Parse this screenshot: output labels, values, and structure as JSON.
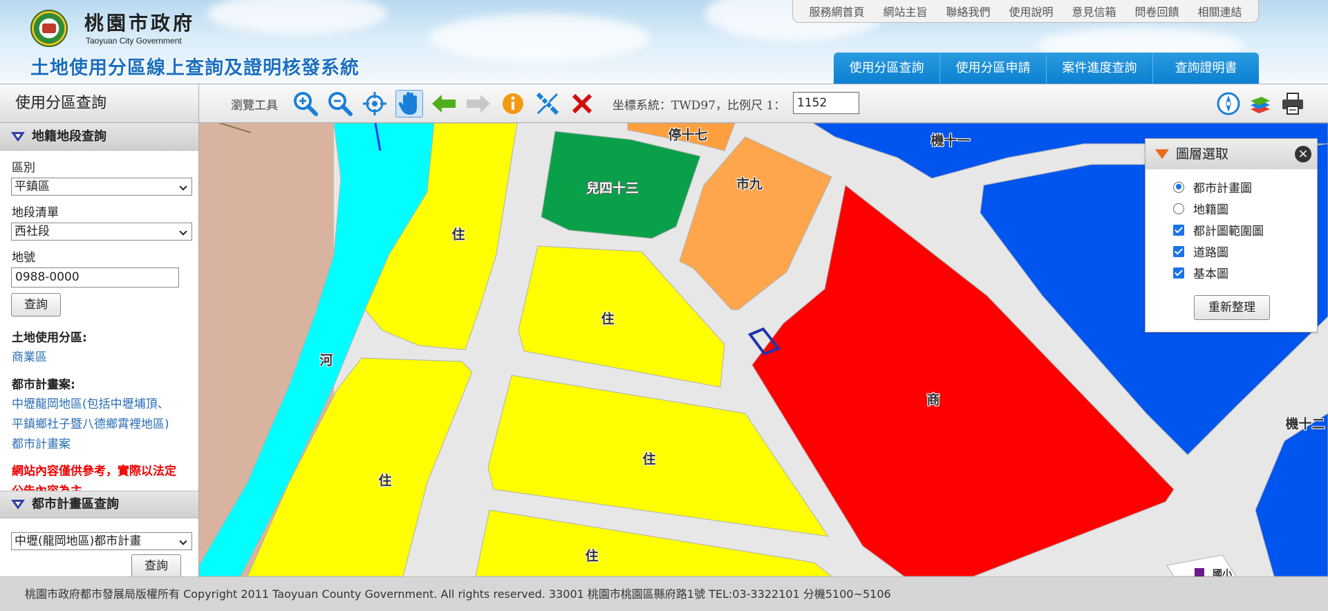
{
  "header": {
    "gov_name": "桃園市政府",
    "gov_name_en": "Taoyuan City Government",
    "system_title": "土地使用分區線上查詢及證明核發系統",
    "top_links": [
      "服務網首頁",
      "網站主旨",
      "聯絡我們",
      "使用說明",
      "意見信箱",
      "問卷回饋",
      "相關連結"
    ],
    "main_nav": [
      "使用分區查詢",
      "使用分區申請",
      "案件進度查詢",
      "查詢證明書"
    ]
  },
  "sidebar": {
    "title": "使用分區查詢",
    "land_section": {
      "heading": "地籍地段查詢",
      "district_label": "區別",
      "district_value": "平鎮區",
      "section_label": "地段清單",
      "section_value": "西社段",
      "lot_label": "地號",
      "lot_value": "0988-0000",
      "query_button": "查詢",
      "zoning_label": "土地使用分區:",
      "zoning_value": "商業區",
      "plan_label": "都市計畫案:",
      "plan_line1": "中壢龍岡地區(包括中壢埔頂、",
      "plan_line2": "平鎮鄉社子暨八德鄉霄裡地區)",
      "plan_line3": "都市計畫案",
      "warning_line1": "網站內容僅供參考，實際以法定",
      "warning_line2": "公告內容為主。"
    },
    "plan_section": {
      "heading": "都市計畫區查詢",
      "plan_value": "中壢(龍岡地區)都市計畫",
      "query_button": "查詢"
    }
  },
  "toolbar": {
    "label": "瀏覽工具",
    "coord_text": "坐標系統：TWD97，比例尺 1：",
    "scale_value": "1152",
    "tools": [
      "zoom-in-icon",
      "zoom-out-icon",
      "full-extent-icon",
      "pan-hand-icon",
      "back-arrow-icon",
      "forward-arrow-icon",
      "info-icon",
      "measure-icon",
      "clear-icon"
    ]
  },
  "map": {
    "labels": {
      "ting17": "停十七",
      "er43": "兒四十三",
      "shi9": "市九",
      "ji11": "機十一",
      "ji12": "機十二",
      "river": "河",
      "shang": "商",
      "zhu": "住",
      "guo": "國小"
    },
    "colors": {
      "residential": "#ffff00",
      "commercial": "#ff0000",
      "river": "#00ffff",
      "park": "#0aa04a",
      "market": "#ffa64d",
      "institution": "#0055ee",
      "agricultural": "#d8b4a0",
      "road": "#e7e7e7"
    }
  },
  "layer_panel": {
    "title": "圖層選取",
    "options": [
      {
        "label": "都市計畫圖",
        "type": "radio",
        "checked": true
      },
      {
        "label": "地籍圖",
        "type": "radio",
        "checked": false
      },
      {
        "label": "都計圖範圍圖",
        "type": "checkbox",
        "checked": true
      },
      {
        "label": "道路圖",
        "type": "checkbox",
        "checked": true
      },
      {
        "label": "基本圖",
        "type": "checkbox",
        "checked": true
      }
    ],
    "refresh_button": "重新整理"
  },
  "footer": {
    "text": "桃園市政府都市發展局版權所有 Copyright 2011 Taoyuan County Government. All rights reserved. 33001 桃園市桃園區縣府路1號 TEL:03-3322101 分機5100~5106"
  }
}
